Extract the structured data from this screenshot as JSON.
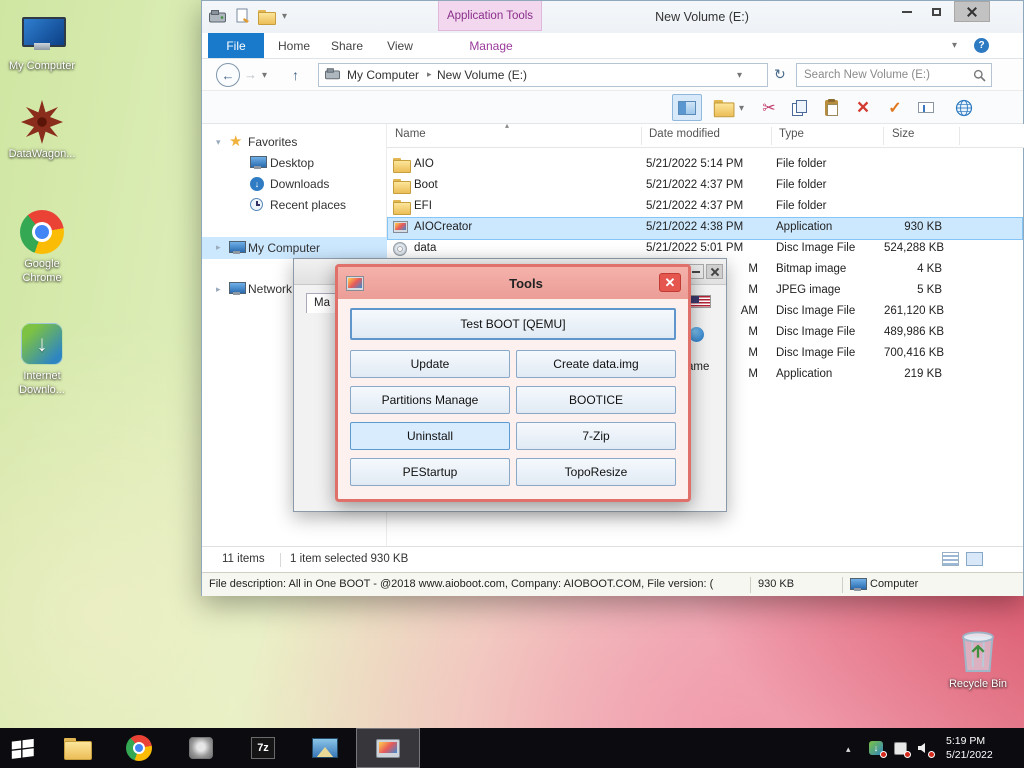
{
  "colors": {
    "file_tab_blue": "#1979ca",
    "selection_blue": "#cce8ff",
    "dialog_border_red": "#e0706a",
    "contextual_tab_pink": "#f2d7ef"
  },
  "desktop": {
    "icons": [
      {
        "label": "My Computer"
      },
      {
        "label": "DataWagon..."
      },
      {
        "label": "Google Chrome"
      },
      {
        "label": "Internet Downlo..."
      }
    ],
    "recycle_bin": "Recycle Bin"
  },
  "explorer": {
    "title": "New Volume (E:)",
    "contextual_group": "Application Tools",
    "tabs": {
      "file": "File",
      "home": "Home",
      "share": "Share",
      "view": "View",
      "manage": "Manage"
    },
    "help": "?",
    "address": {
      "crumb1": "My Computer",
      "crumb2": "New Volume (E:)"
    },
    "search_placeholder": "Search New Volume (E:)",
    "columns": {
      "name": "Name",
      "date": "Date modified",
      "type": "Type",
      "size": "Size"
    },
    "sidebar": {
      "favorites": "Favorites",
      "favorites_items": [
        "Desktop",
        "Downloads",
        "Recent places"
      ],
      "computer": "My Computer",
      "network": "Network"
    },
    "files": [
      {
        "name": "AIO",
        "date": "5/21/2022 5:14 PM",
        "type": "File folder",
        "size": ""
      },
      {
        "name": "Boot",
        "date": "5/21/2022 4:37 PM",
        "type": "File folder",
        "size": ""
      },
      {
        "name": "EFI",
        "date": "5/21/2022 4:37 PM",
        "type": "File folder",
        "size": ""
      },
      {
        "name": "AIOCreator",
        "date": "5/21/2022 4:38 PM",
        "type": "Application",
        "size": "930 KB"
      },
      {
        "name": "data",
        "date": "5/21/2022 5:01 PM",
        "type": "Disc Image File",
        "size": "524,288 KB"
      },
      {
        "name": "",
        "date": "M",
        "type": "Bitmap image",
        "size": "4 KB"
      },
      {
        "name": "",
        "date": "M",
        "type": "JPEG image",
        "size": "5 KB"
      },
      {
        "name": "",
        "date": "AM",
        "type": "Disc Image File",
        "size": "261,120 KB"
      },
      {
        "name": "",
        "date": "M",
        "type": "Disc Image File",
        "size": "489,986 KB"
      },
      {
        "name": "",
        "date": "M",
        "type": "Disc Image File",
        "size": "700,416 KB"
      },
      {
        "name": "",
        "date": "M",
        "type": "Application",
        "size": "219 KB"
      }
    ],
    "status": {
      "items": "11 items",
      "selected": "1 item selected 930 KB"
    },
    "details": {
      "description": "File description: All in One BOOT - @2018 www.aioboot.com, Company: AIOBOOT.COM, File version: (",
      "size": "930 KB",
      "computer": "Computer"
    }
  },
  "aiocreator_window": {
    "tab_fragment": "Ma",
    "text_fragment": "ame"
  },
  "tools_dialog": {
    "title": "Tools",
    "close_glyph": "✕",
    "buttons": {
      "test_boot": "Test BOOT [QEMU]",
      "update": "Update",
      "create_data": "Create data.img",
      "partitions": "Partitions Manage",
      "bootice": "BOOTICE",
      "uninstall": "Uninstall",
      "seven_zip": "7-Zip",
      "pestartup": "PEStartup",
      "toporesize": "TopoResize"
    }
  },
  "taskbar": {
    "seven_zip_glyph": "7z",
    "clock": {
      "time": "5:19 PM",
      "date": "5/21/2022"
    }
  }
}
